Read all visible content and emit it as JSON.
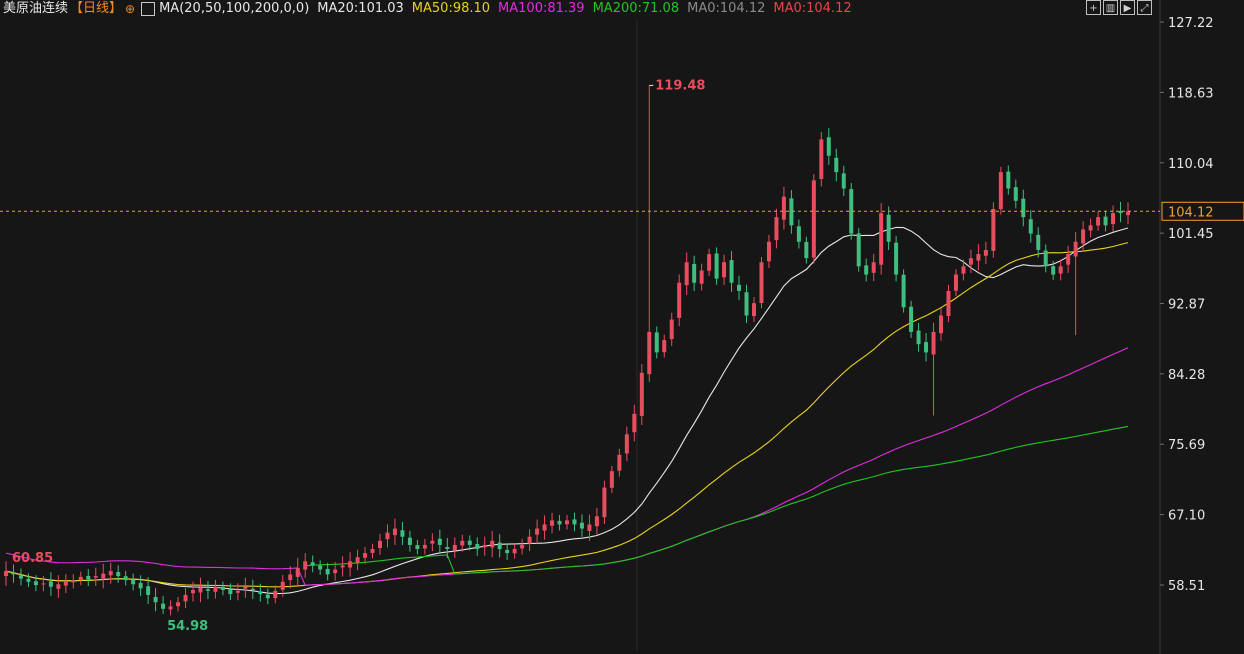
{
  "header": {
    "instrument": "美原油连续",
    "period": "【日线】",
    "settings_icon": "settings-icon",
    "ma_params": "MA(20,50,100,200,0,0)",
    "indicators": [
      {
        "label": "MA20:101.03",
        "color": "#e6e6e6"
      },
      {
        "label": "MA50:98.10",
        "color": "#e8d21d"
      },
      {
        "label": "MA100:81.39",
        "color": "#e02de0"
      },
      {
        "label": "MA200:71.08",
        "color": "#22c422"
      },
      {
        "label": "MA0:104.12",
        "color": "#8a8a8a"
      },
      {
        "label": "MA0:104.12",
        "color": "#e84545"
      }
    ]
  },
  "toolbar": {
    "icons": [
      "crosshair-icon",
      "layout-icon",
      "play-icon",
      "fullscreen-icon"
    ]
  },
  "chart_data": {
    "type": "candlestick",
    "ylim": [
      54,
      127.22
    ],
    "y_ticks": [
      "127.22",
      "118.63",
      "110.04",
      "101.45",
      "92.87",
      "84.28",
      "75.69",
      "67.10",
      "58.51"
    ],
    "last_price": "104.12",
    "high_label": "119.48",
    "low_label": "54.98",
    "left_label": "60.85",
    "colors": {
      "up": "#e84d5f",
      "down": "#3fbf7f",
      "last_line": "#f0a030",
      "label_text": "#e6e6e6"
    },
    "closes": [
      60.2,
      59.8,
      59.3,
      58.9,
      58.5,
      58.7,
      58.3,
      58.6,
      58.9,
      59.1,
      59.5,
      59.2,
      59.6,
      59.9,
      60.2,
      59.6,
      59.1,
      58.6,
      58.1,
      57.3,
      56.4,
      55.6,
      55.9,
      56.4,
      57.3,
      57.9,
      58.2,
      57.8,
      58.3,
      57.9,
      57.4,
      57.8,
      58.3,
      57.9,
      57.4,
      56.9,
      57.8,
      58.9,
      59.8,
      60.6,
      61.4,
      60.9,
      60.4,
      59.8,
      60.4,
      60.9,
      61.4,
      61.9,
      62.4,
      62.9,
      63.9,
      64.9,
      65.4,
      64.4,
      63.4,
      62.9,
      63.4,
      63.9,
      63.4,
      62.9,
      63.4,
      63.9,
      63.4,
      62.9,
      63.4,
      63.9,
      62.9,
      62.4,
      62.9,
      63.4,
      64.4,
      65.4,
      65.9,
      66.4,
      65.9,
      66.4,
      65.9,
      65.4,
      65.9,
      66.9,
      70.4,
      72.4,
      74.4,
      76.9,
      79.4,
      84.4,
      89.4,
      86.9,
      88.4,
      90.9,
      95.4,
      97.9,
      95.4,
      96.9,
      98.9,
      95.9,
      97.9,
      95.4,
      94.4,
      91.4,
      92.9,
      97.9,
      100.4,
      103.4,
      105.9,
      102.4,
      100.4,
      98.4,
      107.9,
      112.9,
      110.9,
      108.9,
      106.9,
      101.4,
      97.4,
      96.4,
      97.9,
      103.9,
      100.4,
      96.4,
      92.4,
      89.4,
      87.9,
      86.9,
      89.4,
      91.4,
      94.4,
      96.4,
      97.4,
      98.4,
      98.9,
      99.4,
      104.4,
      108.9,
      106.9,
      105.4,
      103.4,
      101.4,
      99.4,
      97.4,
      96.4,
      97.4,
      98.9,
      100.4,
      101.9,
      102.4,
      103.4,
      102.4,
      103.9,
      103.9,
      104.1
    ]
  }
}
